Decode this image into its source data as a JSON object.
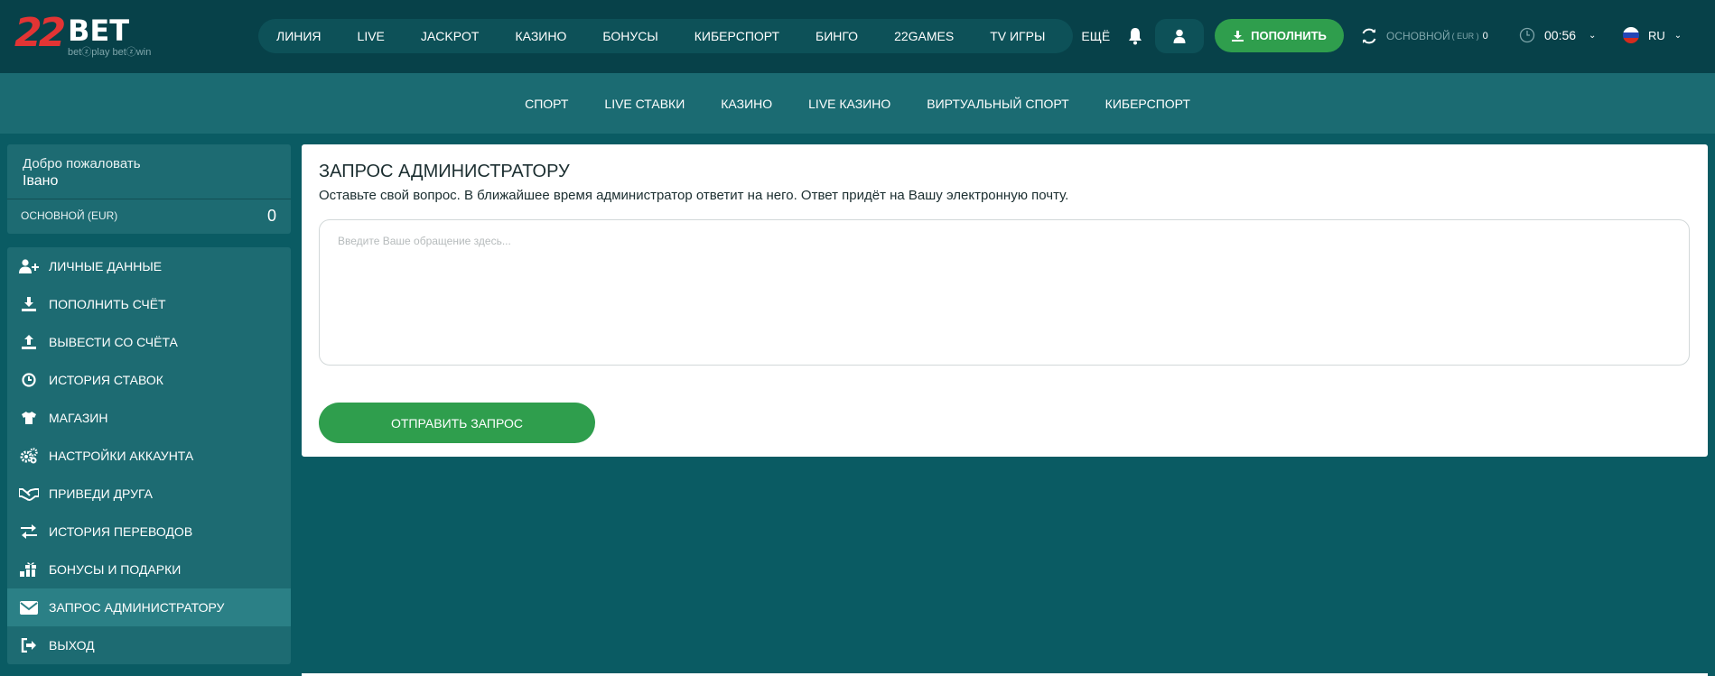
{
  "logo": {
    "number": "22",
    "word": "BET",
    "tagline": "betⓩplay  betⓩwin"
  },
  "main_nav": [
    "ЛИНИЯ",
    "LIVE",
    "JACKPOT",
    "КАЗИНО",
    "БОНУСЫ",
    "КИБЕРСПОРТ",
    "БИНГО",
    "22GAMES",
    "TV ИГРЫ",
    "ЕЩЁ"
  ],
  "header": {
    "deposit_label": "ПОПОЛНИТЬ",
    "balance_label": "ОСНОВНОЙ",
    "balance_currency": "( EUR )",
    "balance_value": "0",
    "time": "00:56",
    "language": "RU"
  },
  "sub_nav": [
    "СПОРТ",
    "LIVE СТАВКИ",
    "КАЗИНО",
    "LIVE КАЗИНО",
    "ВИРТУАЛЬНЫЙ СПОРТ",
    "КИБЕРСПОРТ"
  ],
  "sidebar": {
    "welcome_title": "Добро пожаловать",
    "user_name": "Івано",
    "balance_label": "ОСНОВНОЙ (EUR)",
    "balance_value": "0",
    "items": [
      {
        "label": "ЛИЧНЫЕ ДАННЫЕ",
        "icon": "user-plus-icon"
      },
      {
        "label": "ПОПОЛНИТЬ СЧЁТ",
        "icon": "download-icon"
      },
      {
        "label": "ВЫВЕСТИ СО СЧЁТА",
        "icon": "upload-icon"
      },
      {
        "label": "ИСТОРИЯ СТАВОК",
        "icon": "clock-icon"
      },
      {
        "label": "МАГАЗИН",
        "icon": "tshirt-icon"
      },
      {
        "label": "НАСТРОЙКИ АККАУНТА",
        "icon": "gears-icon"
      },
      {
        "label": "ПРИВЕДИ ДРУГА",
        "icon": "handshake-icon"
      },
      {
        "label": "ИСТОРИЯ ПЕРЕВОДОВ",
        "icon": "exchange-icon"
      },
      {
        "label": "БОНУСЫ И ПОДАРКИ",
        "icon": "gift-icon"
      },
      {
        "label": "ЗАПРОС АДМИНИСТРАТОРУ",
        "icon": "envelope-icon",
        "active": true
      },
      {
        "label": "ВЫХОД",
        "icon": "sign-out-icon"
      }
    ]
  },
  "content": {
    "title": "ЗАПРОС АДМИНИСТРАТОРУ",
    "description": "Оставьте свой вопрос. В ближайшее время администратор ответит на него. Ответ придёт на Вашу электронную почту.",
    "textarea_placeholder": "Введите Ваше обращение здесь...",
    "textarea_value": "",
    "submit_label": "ОТПРАВИТЬ ЗАПРОС"
  },
  "colors": {
    "header_bg": "#074149",
    "page_bg": "#0a5b63",
    "accent_green": "#2f9e4d",
    "logo_red": "#e23434"
  }
}
